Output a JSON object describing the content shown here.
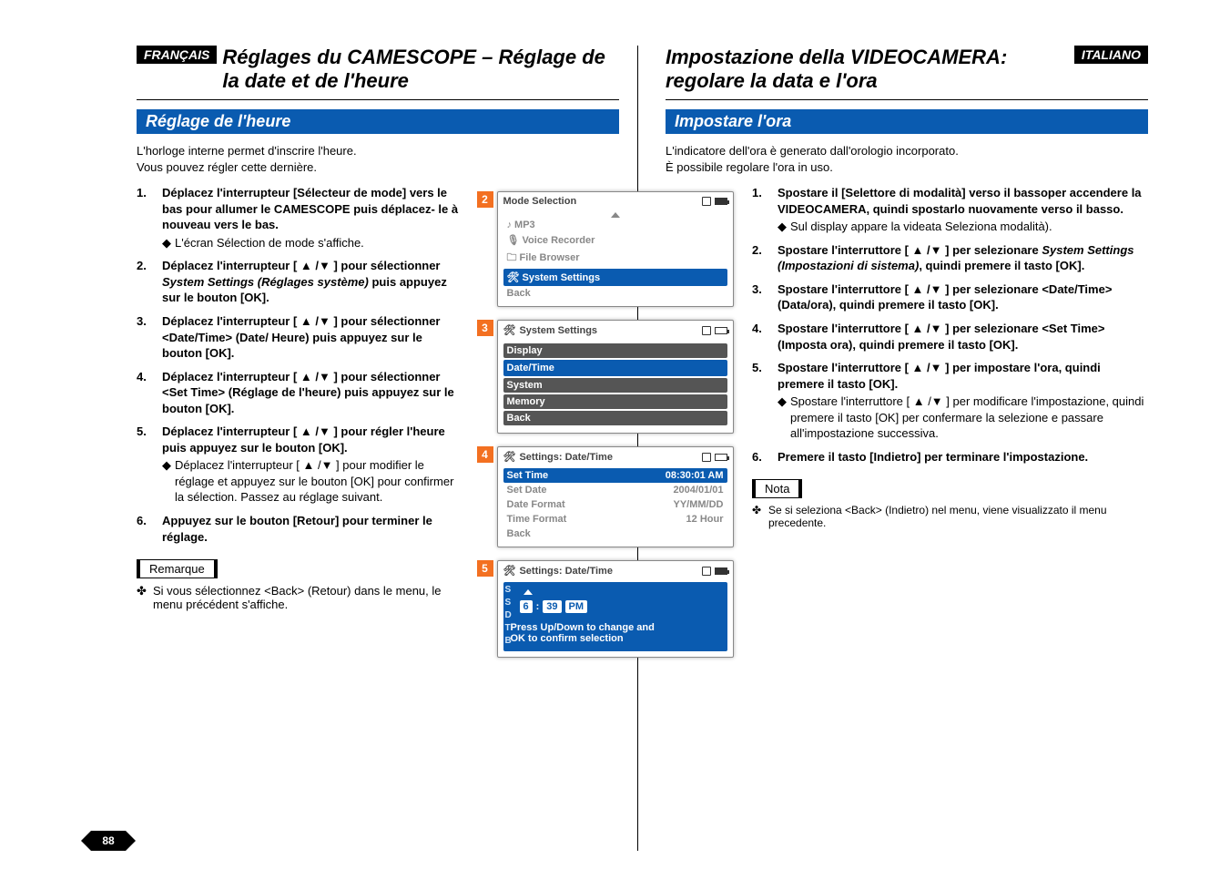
{
  "page_number": "88",
  "left": {
    "lang_badge": "FRANÇAIS",
    "title": "Réglages du CAMESCOPE – Réglage de la date et de l'heure",
    "section": "Réglage de l'heure",
    "intro1": "L'horloge interne permet d'inscrire l'heure.",
    "intro2": "Vous pouvez régler cette dernière.",
    "steps": [
      {
        "num": "1.",
        "bold": "Déplacez l'interrupteur [Sélecteur de mode] vers le bas pour allumer le CAMESCOPE puis déplacez- le à nouveau vers le bas.",
        "sub": "L'écran Sélection de mode s'affiche."
      },
      {
        "num": "2.",
        "pre": "Déplacez l'interrupteur [ ▲ /▼ ] pour sélectionner ",
        "ital": "System Settings (Réglages système)",
        "post": " puis appuyez sur le bouton [OK]."
      },
      {
        "num": "3.",
        "bold": "Déplacez l'interrupteur [ ▲ /▼ ] pour sélectionner <Date/Time> (Date/ Heure) puis appuyez sur le bouton [OK]."
      },
      {
        "num": "4.",
        "bold": "Déplacez l'interrupteur [ ▲ /▼ ] pour sélectionner <Set Time> (Réglage de l'heure) puis appuyez sur le bouton [OK]."
      },
      {
        "num": "5.",
        "bold": "Déplacez l'interrupteur [ ▲ /▼ ] pour régler l'heure puis appuyez sur le bouton [OK].",
        "sub": "Déplacez l'interrupteur [ ▲ /▼ ] pour modifier le réglage et appuyez sur le bouton [OK] pour confirmer la sélection. Passez au réglage suivant."
      },
      {
        "num": "6.",
        "bold": "Appuyez sur le bouton [Retour] pour terminer le réglage."
      }
    ],
    "note_label": "Remarque",
    "note_text": "Si vous sélectionnez <Back> (Retour) dans le menu, le menu précédent s'affiche."
  },
  "right": {
    "lang_badge": "ITALIANO",
    "title": "Impostazione della VIDEOCAMERA: regolare la data e l'ora",
    "section": "Impostare l'ora",
    "intro1": "L'indicatore dell'ora è generato dall'orologio incorporato.",
    "intro2": "È possibile regolare l'ora in uso.",
    "steps": [
      {
        "num": "1.",
        "bold": "Spostare il [Selettore di modalità] verso il bassoper accendere la VIDEOCAMERA, quindi spostarlo nuovamente verso il basso.",
        "sub": "Sul display appare la videata Seleziona modalità)."
      },
      {
        "num": "2.",
        "pre": "Spostare l'interruttore [ ▲ /▼ ] per selezionare ",
        "ital": "System Settings (Impostazioni di sistema)",
        "post": ", quindi premere il tasto [OK]."
      },
      {
        "num": "3.",
        "bold": "Spostare l'interruttore [ ▲ /▼ ] per selezionare <Date/Time> (Data/ora), quindi premere il tasto [OK]."
      },
      {
        "num": "4.",
        "bold": "Spostare l'interruttore [ ▲ /▼ ] per selezionare <Set Time> (Imposta ora), quindi premere il tasto [OK]."
      },
      {
        "num": "5.",
        "bold": "Spostare l'interruttore [ ▲ /▼ ] per impostare l'ora, quindi premere il tasto [OK].",
        "sub": "Spostare l'interruttore [ ▲ /▼ ] per modificare l'impostazione, quindi premere il tasto [OK] per confermare la selezione e passare all'impostazione successiva."
      },
      {
        "num": "6.",
        "bold": "Premere il tasto [Indietro] per terminare l'impostazione."
      }
    ],
    "note_label": "Nota",
    "note_text": "Se si seleziona <Back> (Indietro) nel menu, viene visualizzato il menu precedente."
  },
  "screens": {
    "s2": {
      "badge": "2",
      "title": "Mode Selection",
      "items": [
        "MP3",
        "Voice Recorder",
        "File Browser",
        "System Settings",
        "Back"
      ],
      "selected": "System Settings"
    },
    "s3": {
      "badge": "3",
      "title": "System Settings",
      "items": [
        "Display",
        "Date/Time",
        "System",
        "Memory",
        "Back"
      ],
      "selected": "Date/Time"
    },
    "s4": {
      "badge": "4",
      "title": "Settings: Date/Time",
      "rows": [
        {
          "k": "Set Time",
          "v": "08:30:01 AM",
          "sel": true
        },
        {
          "k": "Set Date",
          "v": "2004/01/01"
        },
        {
          "k": "Date Format",
          "v": "YY/MM/DD"
        },
        {
          "k": "Time Format",
          "v": "12 Hour"
        },
        {
          "k": "Back",
          "v": ""
        }
      ]
    },
    "s5": {
      "badge": "5",
      "title": "Settings: Date/Time",
      "side_letters": "S\nS\nD\nT\nB",
      "time_h": "6",
      "time_m": "39",
      "time_ampm": "PM",
      "press1": "Press Up/Down to change and",
      "press2": "OK to confirm selection"
    }
  }
}
